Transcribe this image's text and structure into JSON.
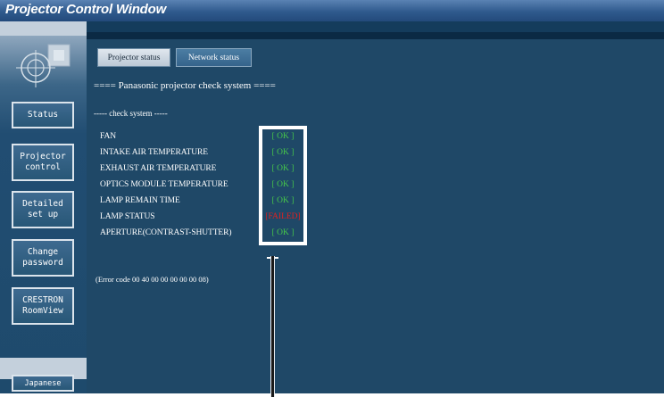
{
  "window": {
    "title": "Projector Control Window"
  },
  "sidebar": {
    "buttons": [
      {
        "label": [
          "Status"
        ]
      },
      {
        "label": [
          "Projector",
          "control"
        ]
      },
      {
        "label": [
          "Detailed",
          "set up"
        ]
      },
      {
        "label": [
          "Change",
          "password"
        ]
      },
      {
        "label": [
          "CRESTRON",
          "RoomView"
        ]
      }
    ],
    "language_button": "Japanese"
  },
  "tabs": [
    {
      "label": "Projector status",
      "active": true
    },
    {
      "label": "Network status",
      "active": false
    }
  ],
  "main": {
    "heading": "==== Panasonic projector check system ====",
    "section_label": "----- check system -----",
    "checks": [
      {
        "name": "FAN",
        "status": "[ OK ]"
      },
      {
        "name": "INTAKE AIR TEMPERATURE",
        "status": "[ OK ]"
      },
      {
        "name": "EXHAUST AIR TEMPERATURE",
        "status": "[ OK ]"
      },
      {
        "name": "OPTICS MODULE TEMPERATURE",
        "status": "[ OK ]"
      },
      {
        "name": "LAMP REMAIN TIME",
        "status": "[ OK ]"
      },
      {
        "name": "LAMP STATUS",
        "status": "[FAILED]"
      },
      {
        "name": "APERTURE(CONTRAST-SHUTTER)",
        "status": "[ OK ]"
      }
    ],
    "error_code": "(Error code 00 40 00 00 00 00 00 08)"
  },
  "colors": {
    "ok": "#46c84a",
    "failed": "#e02020",
    "panel_bg": "#1f4867",
    "title_bar": "#2f5a8d"
  }
}
